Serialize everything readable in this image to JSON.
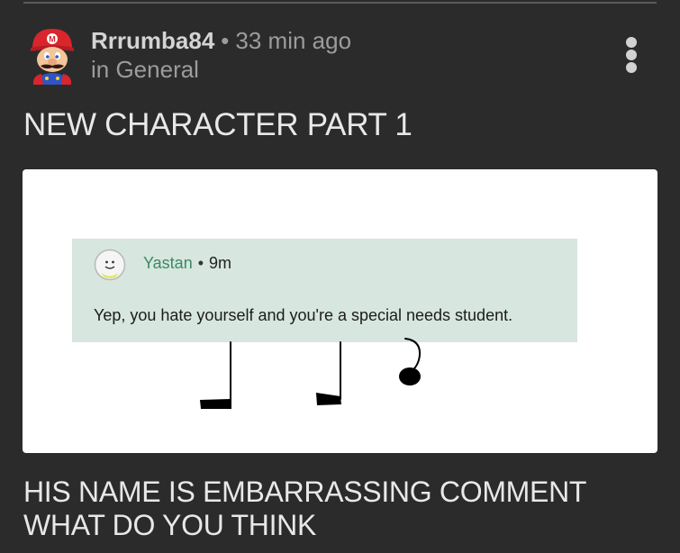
{
  "post": {
    "author": "Rrrumba84",
    "separator": "•",
    "time_ago": "33 min ago",
    "category": "in General",
    "title": "NEW CHARACTER PART 1",
    "caption_lines": [
      "HIS NAME IS EMBARRASSING COMMENT",
      "WHAT DO YOU THINK"
    ]
  },
  "embedded_comment": {
    "author": "Yastan",
    "separator": "•",
    "time": "9m",
    "text": "Yep, you hate yourself and you're a special needs student."
  },
  "icons": {
    "avatar": "mario-avatar",
    "comment_avatar": "smiley-avatar",
    "menu": "more-vertical-icon"
  },
  "colors": {
    "background": "#2b2b2b",
    "text_primary": "#e8e8e8",
    "text_secondary": "#9c9c9c",
    "comment_card": "#d7e6de",
    "comment_author": "#3b8a69"
  }
}
